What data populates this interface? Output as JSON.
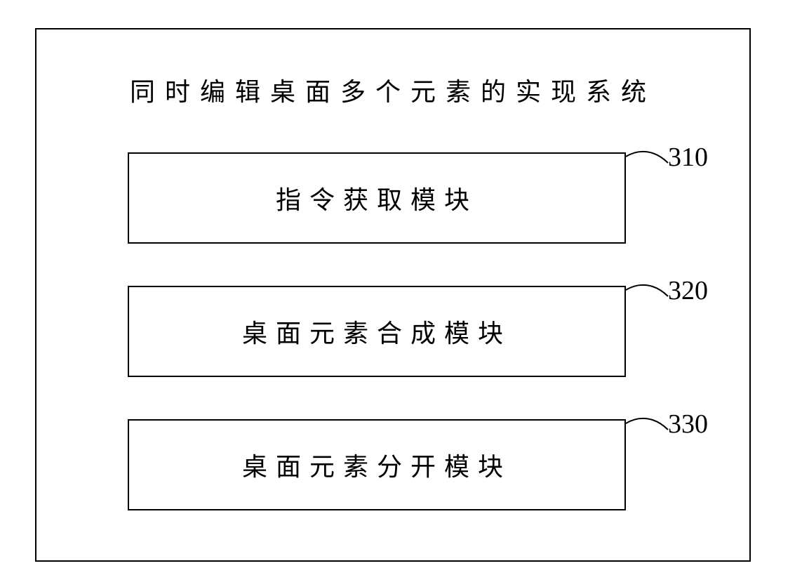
{
  "diagram": {
    "title": "同时编辑桌面多个元素的实现系统",
    "modules": [
      {
        "label": "指令获取模块",
        "ref": "310"
      },
      {
        "label": "桌面元素合成模块",
        "ref": "320"
      },
      {
        "label": "桌面元素分开模块",
        "ref": "330"
      }
    ]
  }
}
